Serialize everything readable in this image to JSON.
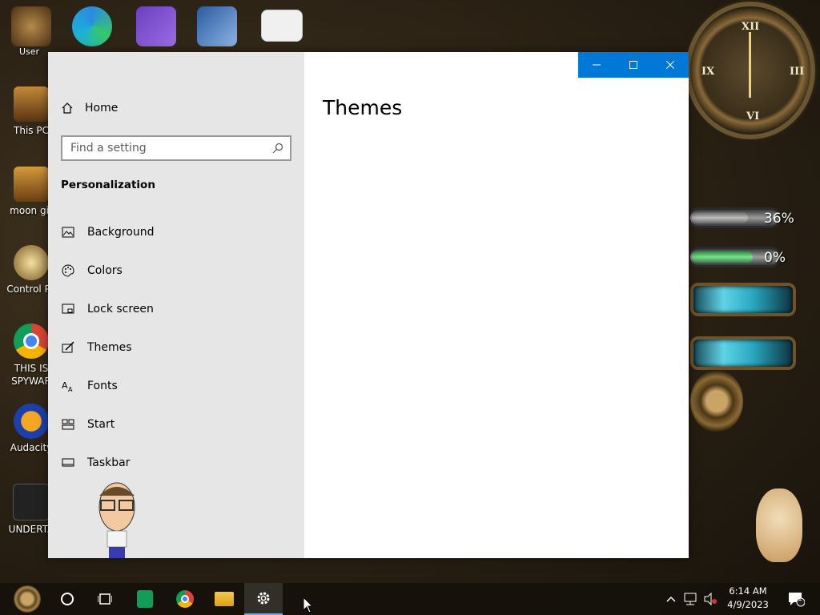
{
  "desktop": {
    "top_icons": [
      {
        "label": "User",
        "name": "user-folder-icon"
      },
      {
        "label": "",
        "name": "edge-icon"
      },
      {
        "label": "",
        "name": "visual-studio-icon"
      },
      {
        "label": "",
        "name": "virtualbox-icon"
      },
      {
        "label": "",
        "name": "hxd-icon"
      }
    ],
    "left_icons": [
      {
        "label": "This PC",
        "name": "this-pc-icon"
      },
      {
        "label": "moon gir",
        "name": "moon-girl-icon"
      },
      {
        "label": "Control Pa",
        "name": "control-panel-icon"
      },
      {
        "label": "THIS IS SPYWAR",
        "name": "chrome-shortcut-icon"
      },
      {
        "label": "Audacity",
        "name": "audacity-icon"
      },
      {
        "label": "UNDERTA",
        "name": "unity-icon"
      }
    ],
    "gauges": [
      {
        "value": "36%",
        "fraction": 0.36,
        "color": "#9a9a9a"
      },
      {
        "value": "0%",
        "fraction": 0.0,
        "color": "#3fbf5a"
      }
    ]
  },
  "window": {
    "controls": {
      "minimize": "—",
      "maximize": "☐",
      "close": "✕"
    },
    "nav": {
      "home": "Home",
      "search_placeholder": "Find a setting",
      "section": "Personalization",
      "items": [
        {
          "label": "Background",
          "icon": "background-icon"
        },
        {
          "label": "Colors",
          "icon": "colors-icon"
        },
        {
          "label": "Lock screen",
          "icon": "lock-screen-icon"
        },
        {
          "label": "Themes",
          "icon": "themes-icon"
        },
        {
          "label": "Fonts",
          "icon": "fonts-icon"
        },
        {
          "label": "Start",
          "icon": "start-icon"
        },
        {
          "label": "Taskbar",
          "icon": "taskbar-icon"
        }
      ]
    },
    "content": {
      "title": "Themes"
    }
  },
  "taskbar": {
    "time": "6:14 AM",
    "date": "4/9/2023",
    "apps": [
      "start-button",
      "cortana",
      "task-view",
      "sheets",
      "chrome",
      "file-explorer",
      "settings"
    ],
    "notification_count": "1"
  },
  "colors": {
    "accent": "#0078d7",
    "nav_bg": "#e6e6e6"
  }
}
